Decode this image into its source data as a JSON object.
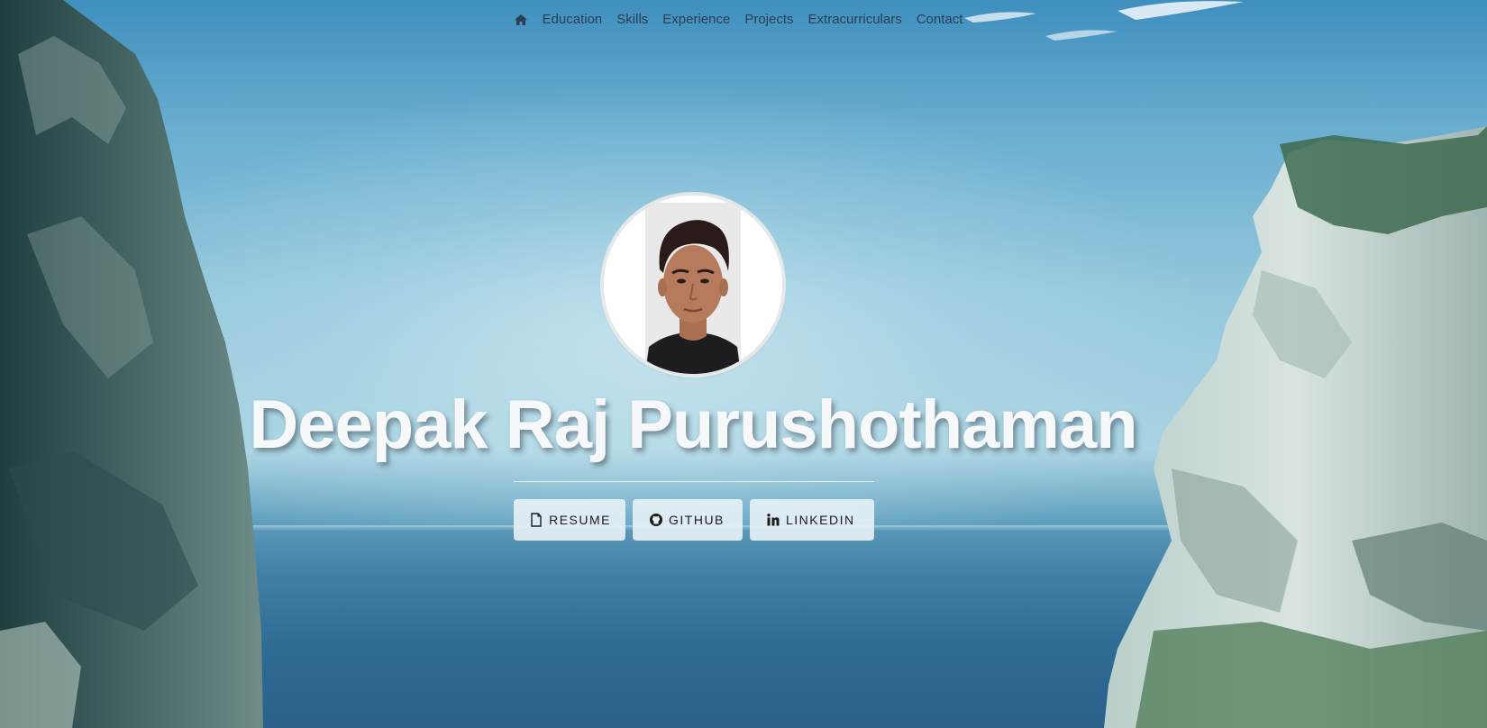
{
  "nav": {
    "home_icon": "home-icon",
    "items": [
      {
        "label": "Education"
      },
      {
        "label": "Skills"
      },
      {
        "label": "Experience"
      },
      {
        "label": "Projects"
      },
      {
        "label": "Extracurriculars"
      },
      {
        "label": "Contact"
      }
    ]
  },
  "hero": {
    "name": "Deepak Raj Purushothaman",
    "avatar_icon": "profile-photo",
    "buttons": [
      {
        "label": "RESUME",
        "icon": "file-icon"
      },
      {
        "label": "GITHUB",
        "icon": "github-icon"
      },
      {
        "label": "LINKEDIN",
        "icon": "linkedin-icon"
      }
    ]
  },
  "colors": {
    "nav_text": "#2c3e50",
    "name_text": "#f6f8f9",
    "button_bg": "#e8f2f6",
    "button_text": "#1c1c1c"
  }
}
